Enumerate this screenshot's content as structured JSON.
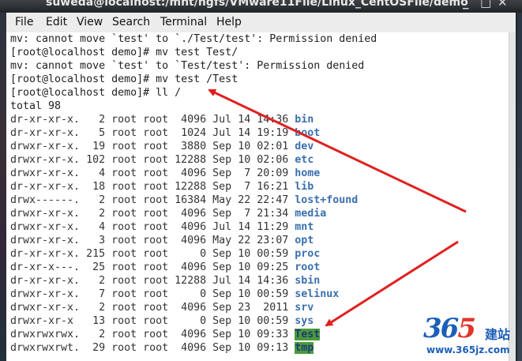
{
  "window": {
    "title": "suweda@localhost:/mnt/hgfs/VMware11File/Linux_CentOSFile/demo",
    "minimize_glyph": "_",
    "maximize_glyph": "□",
    "close_glyph": "✕"
  },
  "menu": [
    "File",
    "Edit",
    "View",
    "Search",
    "Terminal",
    "Help"
  ],
  "terminal": {
    "lines": [
      {
        "text": "mv: cannot move `test' to `./Test/test': Permission denied"
      },
      {
        "text": "[root@localhost demo]# mv test Test/"
      },
      {
        "text": "mv: cannot move `test' to `Test/test': Permission denied"
      },
      {
        "text": "[root@localhost demo]# mv test /Test"
      },
      {
        "text": "[root@localhost demo]# ll /"
      },
      {
        "text": "total 98"
      }
    ],
    "listing": [
      {
        "meta": "dr-xr-xr-x.   2 root root  4096 Jul 14 14:36 ",
        "name": "bin"
      },
      {
        "meta": "dr-xr-xr-x.   5 root root  1024 Jul 14 19:19 ",
        "name": "boot"
      },
      {
        "meta": "drwxr-xr-x.  19 root root  3880 Sep 10 02:01 ",
        "name": "dev"
      },
      {
        "meta": "drwxr-xr-x. 102 root root 12288 Sep 10 02:06 ",
        "name": "etc"
      },
      {
        "meta": "drwxr-xr-x.   4 root root  4096 Sep  7 20:09 ",
        "name": "home"
      },
      {
        "meta": "dr-xr-xr-x.  18 root root 12288 Sep  7 16:21 ",
        "name": "lib"
      },
      {
        "meta": "drwx------.   2 root root 16384 May 22 22:47 ",
        "name": "lost+found"
      },
      {
        "meta": "drwxr-xr-x.   2 root root  4096 Sep  7 21:34 ",
        "name": "media"
      },
      {
        "meta": "drwxr-xr-x.   4 root root  4096 Jul 14 11:29 ",
        "name": "mnt"
      },
      {
        "meta": "drwxr-xr-x.   3 root root  4096 May 22 23:07 ",
        "name": "opt"
      },
      {
        "meta": "dr-xr-xr-x. 215 root root     0 Sep 10 00:59 ",
        "name": "proc"
      },
      {
        "meta": "dr-xr-x---.  25 root root  4096 Sep 10 09:25 ",
        "name": "root"
      },
      {
        "meta": "dr-xr-xr-x.   2 root root 12288 Jul 14 14:36 ",
        "name": "sbin"
      },
      {
        "meta": "drwxr-xr-x.   7 root root     0 Sep 10 00:59 ",
        "name": "selinux"
      },
      {
        "meta": "drwxr-xr-x.   2 root root  4096 Sep 23  2011 ",
        "name": "srv"
      },
      {
        "meta": "drwxr-xr-x   13 root root     0 Sep 10 00:59 ",
        "name": "sys"
      },
      {
        "meta": "drwxrwxrwx.   2 root root  4096 Sep 10 09:33 ",
        "name": "Test",
        "highlight": true
      },
      {
        "meta": "drwxrwxrwt.  29 root root  4096 Sep 10 09:13 ",
        "name": "tmp",
        "highlight": true
      }
    ]
  },
  "watermark": {
    "number_a": "36",
    "number_b": "5",
    "chinese": "建站",
    "url": "www.365jz.com"
  },
  "colors": {
    "directory": "#3b6fb0",
    "highlight_bg": "#4a9a3a",
    "arrow": "#e02020"
  }
}
